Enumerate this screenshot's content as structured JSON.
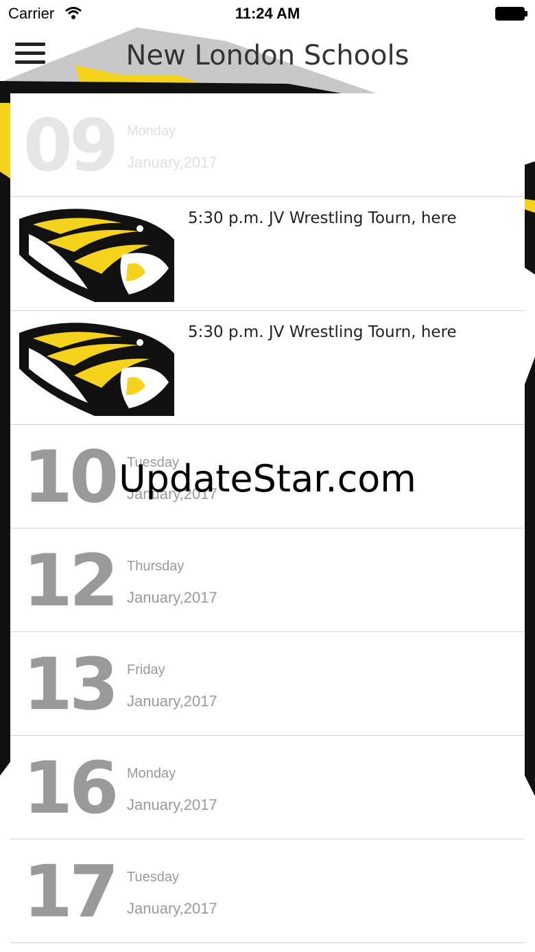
{
  "status_bar": {
    "carrier": "Carrier",
    "time": "11:24 AM"
  },
  "nav": {
    "title": "New London Schools",
    "menu_icon": "hamburger-menu-icon"
  },
  "list": {
    "day_1": {
      "day": "09",
      "weekday": "Monday",
      "month_year": "January,2017"
    },
    "events": [
      {
        "title": "5:30 p.m. JV Wrestling Tourn, here",
        "icon": "tiger-logo"
      },
      {
        "title": "5:30 p.m. JV Wrestling Tourn, here",
        "icon": "tiger-logo"
      }
    ],
    "days": [
      {
        "day": "10",
        "weekday": "Tuesday",
        "month_year": "January,2017"
      },
      {
        "day": "12",
        "weekday": "Thursday",
        "month_year": "January,2017"
      },
      {
        "day": "13",
        "weekday": "Friday",
        "month_year": "January,2017"
      },
      {
        "day": "16",
        "weekday": "Monday",
        "month_year": "January,2017"
      },
      {
        "day": "17",
        "weekday": "Tuesday",
        "month_year": "January,2017"
      }
    ]
  },
  "watermark": "UpdateStar.com",
  "colors": {
    "accent_yellow": "#f5d21c",
    "number_gray": "#9a9a9a",
    "divider": "#d2d2d2"
  }
}
